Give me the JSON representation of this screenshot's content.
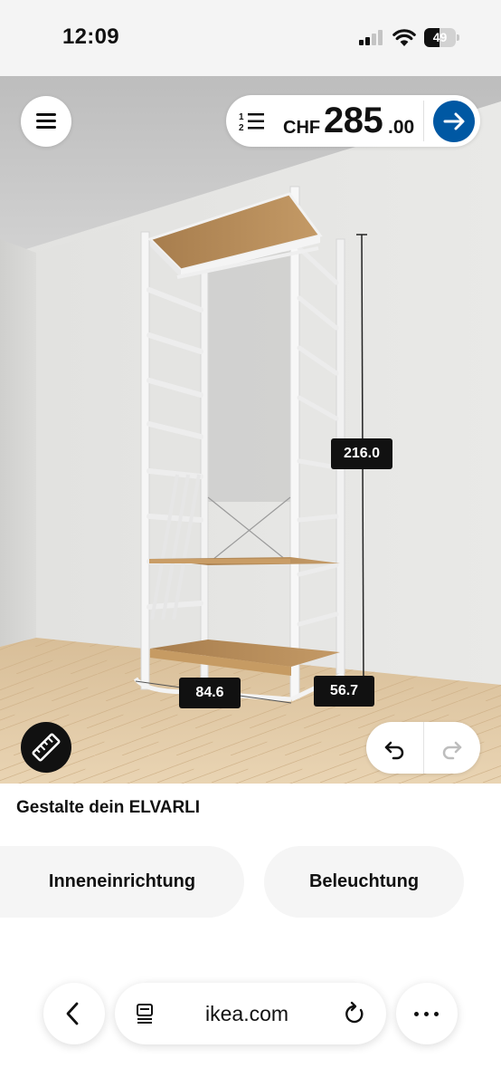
{
  "status_bar": {
    "time": "12:09",
    "battery_percent": "49",
    "battery_level": 0.49,
    "signal_bars_active": 2,
    "signal_bars_total": 4
  },
  "planner": {
    "menu_icon": "hamburger-menu-icon",
    "list_icon": "numbered-list-icon",
    "currency": "CHF",
    "price_main": "285",
    "price_decimals": ".00",
    "proceed_icon": "arrow-right-icon",
    "dimensions": {
      "height": "216.0",
      "width": "84.6",
      "depth": "56.7"
    },
    "measure_icon": "ruler-icon",
    "undo_icon": "undo-icon",
    "redo_icon": "redo-icon",
    "accent_color": "#0058a3"
  },
  "panel": {
    "title": "Gestalte dein ELVARLI",
    "chips": [
      "Inneneinrichtung",
      "Beleuchtung"
    ]
  },
  "browser": {
    "url": "ikea.com",
    "back_icon": "chevron-left-icon",
    "reader_icon": "page-reader-icon",
    "reload_icon": "reload-icon",
    "more_icon": "more-dots-icon"
  }
}
